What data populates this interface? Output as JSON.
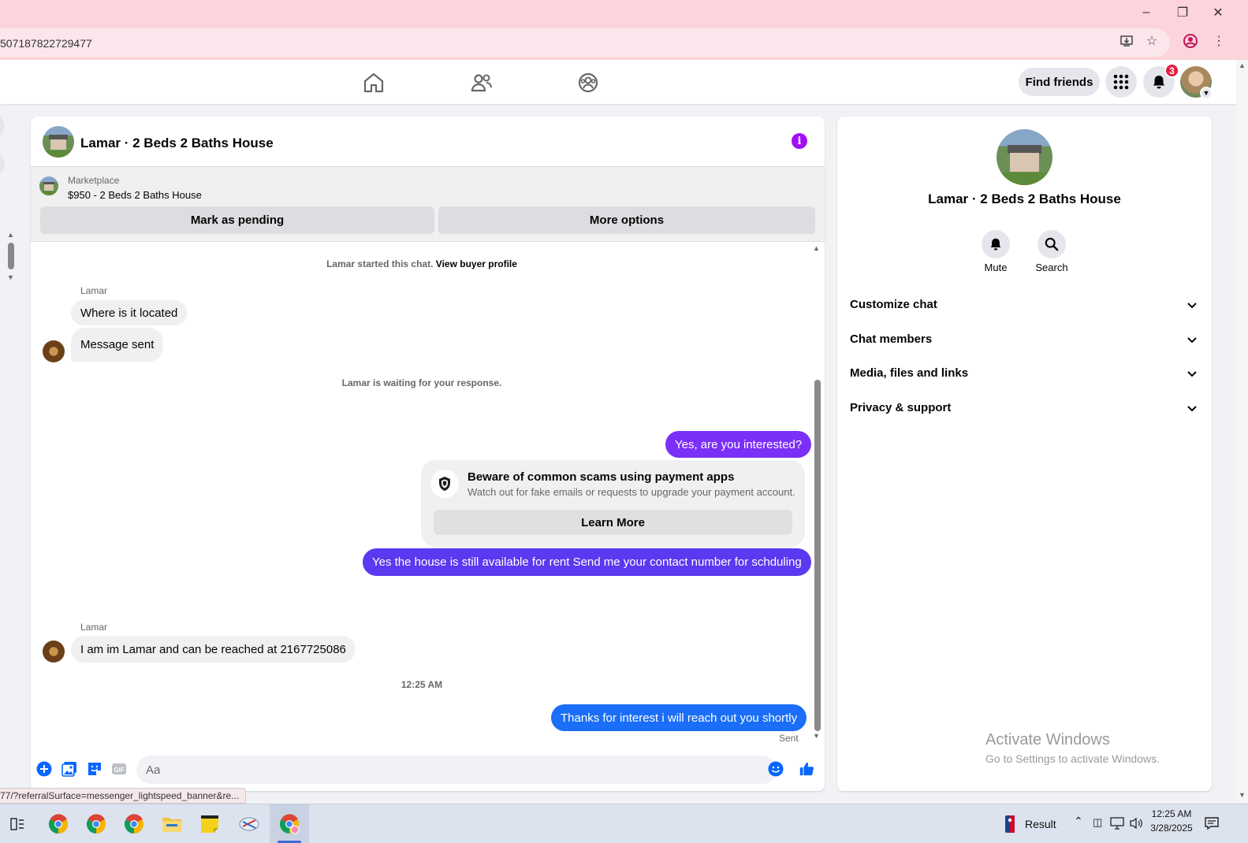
{
  "browser": {
    "url": "507187822729477",
    "status_url": "77/?referralSurface=messenger_lightspeed_banner&re..."
  },
  "header": {
    "find_friends_label": "Find friends",
    "notification_count": "3"
  },
  "chat": {
    "title": "Lamar · 2 Beds 2 Baths House",
    "marketplace_label": "Marketplace",
    "listing": "$950 - 2 Beds 2 Baths House",
    "mark_pending_label": "Mark as pending",
    "more_options_label": "More options",
    "started_text": "Lamar started this chat.",
    "view_profile_label": "View buyer profile",
    "waiting_text": "Lamar is waiting for your response.",
    "messages": [
      {
        "sender": "Lamar",
        "text": "Where is it located",
        "direction": "in"
      },
      {
        "text": "Message sent",
        "direction": "in"
      },
      {
        "text": "Yes, are you interested?",
        "direction": "out",
        "color": "#7b2ff7"
      },
      {
        "text": "Yes the house is still available for rent Send me your contact number for schduling",
        "direction": "out",
        "color": "#5a39f0"
      },
      {
        "sender": "Lamar",
        "text": "I am im Lamar and can be reached at 2167725086",
        "direction": "in"
      },
      {
        "text": "Thanks for interest i will reach out you shortly",
        "direction": "out",
        "color": "#1a6ef7"
      }
    ],
    "scam_notice": {
      "title": "Beware of common scams using payment apps",
      "subtitle": "Watch out for fake emails or requests to upgrade your payment account.",
      "button_label": "Learn More"
    },
    "timestamp": "12:25 AM",
    "sent_status": "Sent",
    "composer_placeholder": "Aa",
    "accent_color": "#0866ff"
  },
  "details": {
    "title": "Lamar · 2 Beds 2 Baths House",
    "actions": [
      {
        "label": "Mute",
        "icon": "bell-icon"
      },
      {
        "label": "Search",
        "icon": "search-icon"
      }
    ],
    "sections": [
      {
        "label": "Customize chat"
      },
      {
        "label": "Chat members"
      },
      {
        "label": "Media, files and links"
      },
      {
        "label": "Privacy & support"
      }
    ]
  },
  "watermark": {
    "line1": "Activate Windows",
    "line2": "Go to Settings to activate Windows."
  },
  "taskbar": {
    "result_label": "Result",
    "time": "12:25 AM",
    "date": "3/28/2025"
  }
}
